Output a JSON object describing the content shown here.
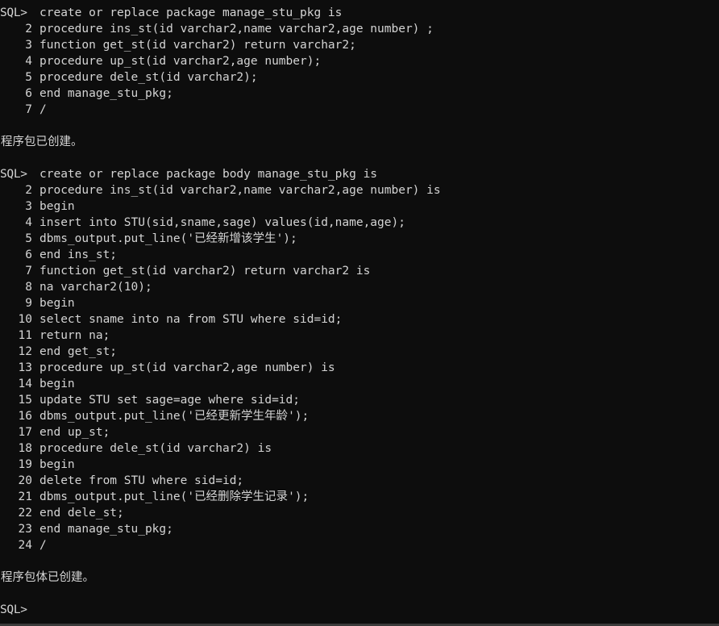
{
  "terminal": {
    "app": "SQL*Plus",
    "prompt": "SQL>",
    "background_color": "#0d0d0d",
    "foreground_color": "#d4d4d4",
    "bottom_edge_color": "#3a3a3a"
  },
  "lines": [
    {
      "type": "command",
      "gutter": "SQL>",
      "text": "create or replace package manage_stu_pkg is"
    },
    {
      "type": "continuation",
      "gutter": "2",
      "text": "procedure ins_st(id varchar2,name varchar2,age number) ;"
    },
    {
      "type": "continuation",
      "gutter": "3",
      "text": "function get_st(id varchar2) return varchar2;"
    },
    {
      "type": "continuation",
      "gutter": "4",
      "text": "procedure up_st(id varchar2,age number);"
    },
    {
      "type": "continuation",
      "gutter": "5",
      "text": "procedure dele_st(id varchar2);"
    },
    {
      "type": "continuation",
      "gutter": "6",
      "text": "end manage_stu_pkg;"
    },
    {
      "type": "continuation",
      "gutter": "7",
      "text": "/"
    },
    {
      "type": "blank",
      "gutter": "",
      "text": ""
    },
    {
      "type": "message",
      "gutter": "",
      "text": "程序包已创建。"
    },
    {
      "type": "blank",
      "gutter": "",
      "text": ""
    },
    {
      "type": "command",
      "gutter": "SQL>",
      "text": "create or replace package body manage_stu_pkg is"
    },
    {
      "type": "continuation",
      "gutter": "2",
      "text": "procedure ins_st(id varchar2,name varchar2,age number) is"
    },
    {
      "type": "continuation",
      "gutter": "3",
      "text": "begin"
    },
    {
      "type": "continuation",
      "gutter": "4",
      "text": "insert into STU(sid,sname,sage) values(id,name,age);"
    },
    {
      "type": "continuation",
      "gutter": "5",
      "text": "dbms_output.put_line('已经新增该学生');"
    },
    {
      "type": "continuation",
      "gutter": "6",
      "text": "end ins_st;"
    },
    {
      "type": "continuation",
      "gutter": "7",
      "text": "function get_st(id varchar2) return varchar2 is"
    },
    {
      "type": "continuation",
      "gutter": "8",
      "text": "na varchar2(10);"
    },
    {
      "type": "continuation",
      "gutter": "9",
      "text": "begin"
    },
    {
      "type": "continuation",
      "gutter": "10",
      "text": "select sname into na from STU where sid=id;"
    },
    {
      "type": "continuation",
      "gutter": "11",
      "text": "return na;"
    },
    {
      "type": "continuation",
      "gutter": "12",
      "text": "end get_st;"
    },
    {
      "type": "continuation",
      "gutter": "13",
      "text": "procedure up_st(id varchar2,age number) is"
    },
    {
      "type": "continuation",
      "gutter": "14",
      "text": "begin"
    },
    {
      "type": "continuation",
      "gutter": "15",
      "text": "update STU set sage=age where sid=id;"
    },
    {
      "type": "continuation",
      "gutter": "16",
      "text": "dbms_output.put_line('已经更新学生年龄');"
    },
    {
      "type": "continuation",
      "gutter": "17",
      "text": "end up_st;"
    },
    {
      "type": "continuation",
      "gutter": "18",
      "text": "procedure dele_st(id varchar2) is"
    },
    {
      "type": "continuation",
      "gutter": "19",
      "text": "begin"
    },
    {
      "type": "continuation",
      "gutter": "20",
      "text": "delete from STU where sid=id;"
    },
    {
      "type": "continuation",
      "gutter": "21",
      "text": "dbms_output.put_line('已经删除学生记录');"
    },
    {
      "type": "continuation",
      "gutter": "22",
      "text": "end dele_st;"
    },
    {
      "type": "continuation",
      "gutter": "23",
      "text": "end manage_stu_pkg;"
    },
    {
      "type": "continuation",
      "gutter": "24",
      "text": "/"
    },
    {
      "type": "blank",
      "gutter": "",
      "text": ""
    },
    {
      "type": "message",
      "gutter": "",
      "text": "程序包体已创建。"
    },
    {
      "type": "blank",
      "gutter": "",
      "text": ""
    },
    {
      "type": "command",
      "gutter": "SQL>",
      "text": ""
    }
  ]
}
